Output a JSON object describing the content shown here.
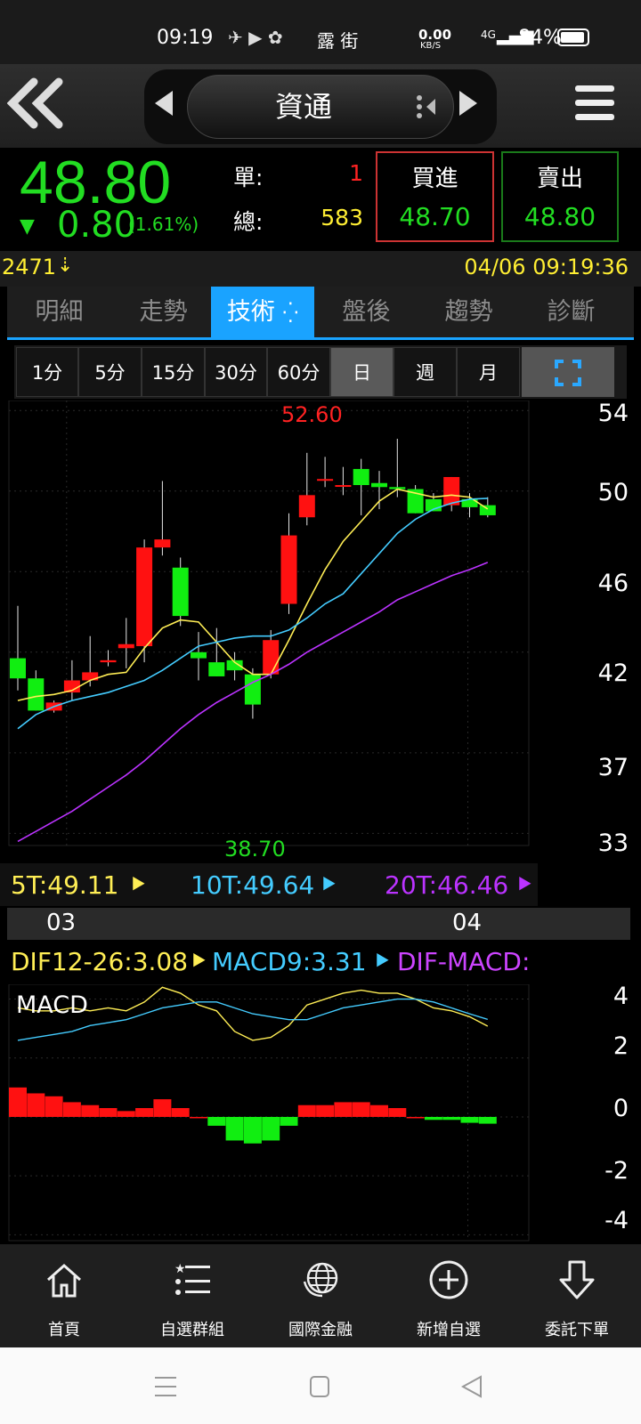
{
  "status_bar": {
    "time": "09:19",
    "chars": "露 街",
    "speed": "0.00",
    "speed_unit": "KB/S",
    "net": "4G",
    "battery": "84%"
  },
  "header": {
    "title": "資通",
    "back_icon": "double-chevron-left-icon",
    "menu_icon": "hamburger-menu-icon"
  },
  "quote": {
    "price": "48.80",
    "change": "0.80",
    "change_pct": "(1.61%)",
    "single_label": "單:",
    "single_value": "1",
    "total_label": "總:",
    "total_value": "583",
    "buy_label": "買進",
    "buy_price": "48.70",
    "sell_label": "賣出",
    "sell_price": "48.80",
    "colors": {
      "down": "#22dd22",
      "up": "#ff2222",
      "volume": "#ffee33"
    }
  },
  "info_bar": {
    "code": "2471",
    "datetime": "04/06 09:19:36"
  },
  "tabs": [
    {
      "label": "明細"
    },
    {
      "label": "走勢"
    },
    {
      "label": "技術"
    },
    {
      "label": "盤後"
    },
    {
      "label": "趨勢"
    },
    {
      "label": "診斷"
    }
  ],
  "periods": [
    {
      "label": "1分"
    },
    {
      "label": "5分"
    },
    {
      "label": "15分"
    },
    {
      "label": "30分"
    },
    {
      "label": "60分"
    },
    {
      "label": "日"
    },
    {
      "label": "週"
    },
    {
      "label": "月"
    }
  ],
  "chart_data": [
    {
      "type": "candlestick",
      "high_label": "52.60",
      "low_label": "38.70",
      "y_ticks": [
        "54",
        "50",
        "46",
        "42",
        "37",
        "33"
      ],
      "ylim": [
        32.4,
        54.5
      ],
      "x_ticks": [
        "03",
        "04"
      ],
      "candles": [
        {
          "o": 41.7,
          "h": 44.3,
          "l": 40.1,
          "c": 40.7
        },
        {
          "o": 40.7,
          "h": 41.1,
          "l": 39.1,
          "c": 39.1
        },
        {
          "o": 39.1,
          "h": 39.6,
          "l": 39.0,
          "c": 39.5
        },
        {
          "o": 40.0,
          "h": 41.6,
          "l": 39.6,
          "c": 40.6
        },
        {
          "o": 40.6,
          "h": 42.8,
          "l": 40.3,
          "c": 41.0
        },
        {
          "o": 41.5,
          "h": 42.1,
          "l": 41.3,
          "c": 41.6
        },
        {
          "o": 42.2,
          "h": 43.7,
          "l": 41.2,
          "c": 42.4
        },
        {
          "o": 42.3,
          "h": 47.6,
          "l": 41.5,
          "c": 47.2
        },
        {
          "o": 47.2,
          "h": 50.5,
          "l": 46.8,
          "c": 47.6
        },
        {
          "o": 46.2,
          "h": 46.7,
          "l": 43.3,
          "c": 43.8
        },
        {
          "o": 42.0,
          "h": 43.0,
          "l": 40.6,
          "c": 41.7
        },
        {
          "o": 41.5,
          "h": 43.2,
          "l": 40.8,
          "c": 40.8
        },
        {
          "o": 41.6,
          "h": 42.0,
          "l": 40.6,
          "c": 41.1
        },
        {
          "o": 40.9,
          "h": 41.2,
          "l": 38.7,
          "c": 39.4
        },
        {
          "o": 40.9,
          "h": 43.1,
          "l": 40.7,
          "c": 42.6
        },
        {
          "o": 44.4,
          "h": 48.9,
          "l": 43.9,
          "c": 47.8
        },
        {
          "o": 48.7,
          "h": 51.9,
          "l": 48.3,
          "c": 49.8
        },
        {
          "o": 50.6,
          "h": 51.7,
          "l": 50.2,
          "c": 50.6
        },
        {
          "o": 50.3,
          "h": 51.2,
          "l": 49.8,
          "c": 50.3
        },
        {
          "o": 51.1,
          "h": 51.6,
          "l": 48.8,
          "c": 50.3
        },
        {
          "o": 50.4,
          "h": 51.0,
          "l": 49.1,
          "c": 50.2
        },
        {
          "o": 50.2,
          "h": 52.6,
          "l": 49.7,
          "c": 50.1
        },
        {
          "o": 50.1,
          "h": 50.3,
          "l": 48.9,
          "c": 48.9
        },
        {
          "o": 49.6,
          "h": 49.9,
          "l": 49.0,
          "c": 49.0
        },
        {
          "o": 49.3,
          "h": 50.7,
          "l": 49.0,
          "c": 50.7
        },
        {
          "o": 49.6,
          "h": 49.9,
          "l": 48.7,
          "c": 49.2
        },
        {
          "o": 49.3,
          "h": 49.7,
          "l": 48.7,
          "c": 48.8
        }
      ],
      "series": [
        {
          "name": "5T",
          "label": "5T:49.11",
          "color": "#ffee55",
          "values": [
            39.6,
            39.8,
            39.9,
            40.1,
            40.6,
            40.9,
            41.0,
            42.2,
            43.2,
            43.6,
            43.5,
            42.5,
            41.5,
            40.9,
            40.9,
            42.6,
            44.4,
            46.1,
            47.5,
            48.5,
            49.5,
            50.1,
            49.9,
            49.7,
            49.8,
            49.7,
            49.11
          ]
        },
        {
          "name": "10T",
          "label": "10T:49.64",
          "color": "#44ccff",
          "values": [
            38.2,
            38.9,
            39.3,
            39.6,
            39.8,
            40.0,
            40.3,
            40.6,
            41.1,
            41.7,
            42.3,
            42.5,
            42.7,
            42.8,
            42.8,
            43.1,
            43.7,
            44.4,
            44.9,
            45.9,
            46.9,
            47.9,
            48.6,
            49.1,
            49.4,
            49.6,
            49.64
          ]
        },
        {
          "name": "20T",
          "label": "20T:46.46",
          "color": "#bb33ff",
          "values": [
            32.6,
            33.1,
            33.6,
            34.1,
            34.7,
            35.3,
            35.9,
            36.6,
            37.4,
            38.2,
            38.9,
            39.5,
            40.0,
            40.5,
            40.9,
            41.4,
            42.0,
            42.5,
            43.0,
            43.5,
            44.0,
            44.6,
            45.0,
            45.4,
            45.8,
            46.1,
            46.46
          ]
        }
      ]
    },
    {
      "type": "macd",
      "title": "MACD",
      "y_ticks": [
        "4",
        "2",
        "0",
        "-2",
        "-4"
      ],
      "ylim": [
        -4.2,
        4.5
      ],
      "series": [
        {
          "name": "DIF12-26",
          "label": "DIF12-26:3.08",
          "color": "#ffee55",
          "values": [
            3.7,
            3.6,
            3.6,
            3.7,
            3.6,
            3.7,
            3.6,
            3.9,
            4.4,
            4.2,
            3.8,
            3.6,
            2.9,
            2.6,
            2.7,
            3.1,
            3.8,
            4.0,
            4.2,
            4.3,
            4.2,
            4.2,
            4.0,
            3.7,
            3.6,
            3.4,
            3.08
          ]
        },
        {
          "name": "MACD9",
          "label": "MACD9:3.31",
          "color": "#44ccff",
          "values": [
            2.6,
            2.7,
            2.8,
            2.9,
            3.1,
            3.2,
            3.3,
            3.5,
            3.7,
            3.8,
            3.9,
            3.9,
            3.7,
            3.5,
            3.4,
            3.3,
            3.3,
            3.5,
            3.7,
            3.8,
            3.9,
            4.0,
            4.0,
            3.9,
            3.7,
            3.5,
            3.31
          ]
        },
        {
          "name": "DIF-MACD",
          "label": "DIF-MACD:",
          "color": "#cc44ff"
        }
      ],
      "histogram": [
        1.0,
        0.8,
        0.7,
        0.5,
        0.4,
        0.3,
        0.2,
        0.3,
        0.6,
        0.3,
        0.0,
        -0.3,
        -0.8,
        -0.9,
        -0.8,
        -0.3,
        0.4,
        0.4,
        0.5,
        0.5,
        0.4,
        0.3,
        0.0,
        -0.1,
        -0.1,
        -0.2,
        -0.23
      ]
    }
  ],
  "bottom_nav": [
    {
      "label": "首頁",
      "icon": "home-icon"
    },
    {
      "label": "自選群組",
      "icon": "list-star-icon"
    },
    {
      "label": "國際金融",
      "icon": "globe-icon"
    },
    {
      "label": "新增自選",
      "icon": "plus-circle-icon"
    },
    {
      "label": "委託下單",
      "icon": "order-arrow-icon"
    }
  ],
  "system_nav": [
    "menu-icon",
    "home-square-icon",
    "back-triangle-icon"
  ]
}
